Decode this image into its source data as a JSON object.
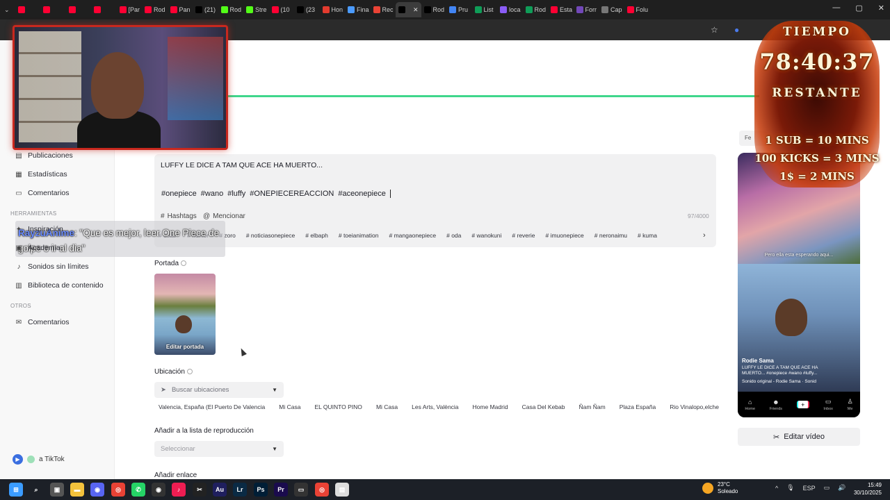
{
  "browser": {
    "tabs": [
      {
        "label": "",
        "color": "#ff0033"
      },
      {
        "label": "",
        "color": "#ff0033"
      },
      {
        "label": "",
        "color": "#ff0033"
      },
      {
        "label": "",
        "color": "#ff0033"
      },
      {
        "label": "[Par",
        "color": "#ff0033"
      },
      {
        "label": "Rod",
        "color": "#ff0033"
      },
      {
        "label": "Pan",
        "color": "#ff0033"
      },
      {
        "label": "(21)",
        "color": "#000000"
      },
      {
        "label": "Rod",
        "color": "#53fc18"
      },
      {
        "label": "Stre",
        "color": "#53fc18"
      },
      {
        "label": "(10",
        "color": "#ff0033"
      },
      {
        "label": "(23",
        "color": "#000000"
      },
      {
        "label": "Hon",
        "color": "#e33b2e"
      },
      {
        "label": "Fina",
        "color": "#4b9bff"
      },
      {
        "label": "Rec",
        "color": "#ea4335"
      },
      {
        "label": "",
        "color": "#000000",
        "active": true
      },
      {
        "label": "Rod",
        "color": "#000000"
      },
      {
        "label": "Pru",
        "color": "#4285f4"
      },
      {
        "label": "List",
        "color": "#0f9d58"
      },
      {
        "label": "loca",
        "color": "#8a5cf6"
      },
      {
        "label": "Rod",
        "color": "#0f9d58"
      },
      {
        "label": "Esta",
        "color": "#ff0033"
      },
      {
        "label": "Forr",
        "color": "#7248b9"
      },
      {
        "label": "Cap",
        "color": "#777777"
      },
      {
        "label": "Folu",
        "color": "#ff0033"
      }
    ]
  },
  "sidebar": {
    "items_top": [
      {
        "label": "Publicaciones",
        "icon": "document-icon"
      },
      {
        "label": "Estadísticas",
        "icon": "chart-icon"
      },
      {
        "label": "Comentarios",
        "icon": "comment-icon"
      }
    ],
    "section_tools": "HERRAMIENTAS",
    "tools": [
      {
        "label": "Inspiración",
        "icon": "bulb-icon"
      },
      {
        "label": "Academia",
        "icon": "book-icon"
      },
      {
        "label": "Sonidos sin límites",
        "icon": "music-note-icon"
      },
      {
        "label": "Biblioteca de contenido",
        "icon": "library-icon"
      }
    ],
    "section_other": "OTROS",
    "other": [
      {
        "label": "Comentarios",
        "icon": "feedback-icon"
      }
    ],
    "back_link": "a TikTok"
  },
  "editor": {
    "title_text": "LUFFY LE DICE A TAM QUE ACE HA MUERTO...",
    "tags": [
      "#onepiece",
      "#wano",
      "#luffy",
      "#ONEPIECEREACCION",
      "#aceonepiece"
    ],
    "hashtags_label": "Hashtags",
    "mention_label": "Mencionar",
    "char_count": "97/4000",
    "suggestions": [
      "# dstar",
      "# humor",
      "# zoro",
      "# noticiasonepiece",
      "# elbaph",
      "# toeianimation",
      "# mangaonepiece",
      "# oda",
      "# wanokuni",
      "# reverie",
      "# imuonepiece",
      "# neronaimu",
      "# kuma"
    ]
  },
  "cover": {
    "label": "Portada",
    "edit_label": "Editar portada"
  },
  "location": {
    "label": "Ubicación",
    "placeholder": "Buscar ubicaciones",
    "suggestions": [
      "Valencia, España (El Puerto De Valencia",
      "Mi Casa",
      "EL QUINTO PINO",
      "Mi Casa",
      "Les Arts, València",
      "Home Madrid",
      "Casa Del Kebab",
      "Ñam Ñam",
      "Plaza España",
      "Rio Vinalopo,elche"
    ]
  },
  "playlist": {
    "label": "Añadir a la lista de reproducción",
    "placeholder": "Seleccionar"
  },
  "link": {
    "label": "Añadir enlace"
  },
  "preview": {
    "tab_label": "Fe",
    "caption_overlay": "Pero ella esta esperando aqui...",
    "user": "Rodie Sama",
    "caption": "LUFFY LE DICE A TAM QUE ACE HA MUERTO... #onepiece #wano #luffy...",
    "sound": "Sonido original - Rodie Sama · Sonid",
    "nav": [
      {
        "label": "Home",
        "icon": "home-icon"
      },
      {
        "label": "Friends",
        "icon": "friends-icon"
      },
      {
        "label": "",
        "icon": "plus-icon"
      },
      {
        "label": "Inbox",
        "icon": "inbox-icon"
      },
      {
        "label": "Me",
        "icon": "profile-icon"
      }
    ],
    "edit_button": "Editar vídeo"
  },
  "overlay": {
    "chat_user": "RayzuAnime",
    "chat_text": ": \"Que es mejor, leer One Piece de golpe o ir al dia\"",
    "timer_title": "TIEMPO",
    "timer_value": "78:40:37",
    "timer_sub": "RESTANTE",
    "rules": [
      "1 SUB = 10 MINS",
      "100 KICKS = 3 MINS",
      "1$ = 2 MINS"
    ]
  },
  "taskbar": {
    "weather_temp": "23°C",
    "weather_desc": "Soleado",
    "weather_badge": "1",
    "lang": "ESP",
    "time": "15:49",
    "date": "30/10/2025"
  }
}
